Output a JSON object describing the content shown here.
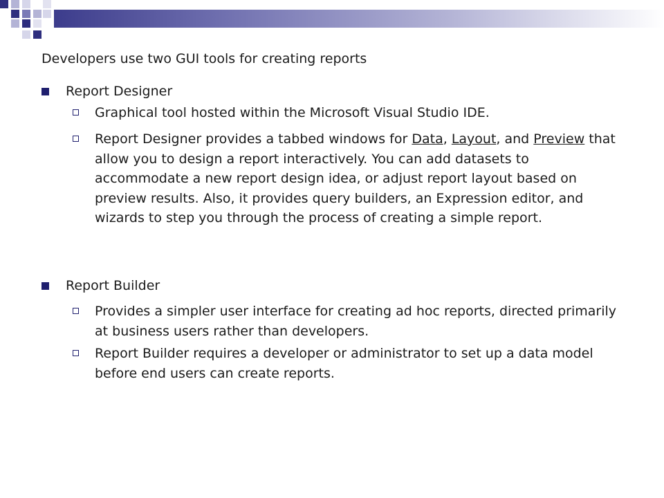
{
  "slide": {
    "intro": "Developers use two GUI tools for creating reports",
    "sections": [
      {
        "heading": "Report Designer",
        "items": [
          {
            "text": "Graphical tool hosted within the Microsoft Visual Studio IDE."
          },
          {
            "parts": [
              "Report Designer provides a tabbed windows for ",
              "Data",
              ", ",
              "Layout",
              ", and ",
              "Preview",
              " that allow you to design a report interactively. You can add datasets to accommodate a new report design idea, or adjust report layout based on preview results. Also, it provides query builders, an Expression editor, and wizards to step you through the process of creating a simple report."
            ]
          }
        ]
      },
      {
        "heading": "Report Builder",
        "items": [
          {
            "text": "Provides a simpler user interface for creating ad hoc reports, directed primarily at business users rather than developers."
          },
          {
            "text": "Report Builder requires a developer or administrator to set up a data model before end users can create reports."
          }
        ]
      }
    ]
  },
  "colors": {
    "bullet": "#1f1f6e",
    "bar_start": "#3c3c8c",
    "square_dark": "#2e2e7e",
    "square_light": "#b4b4d6"
  }
}
